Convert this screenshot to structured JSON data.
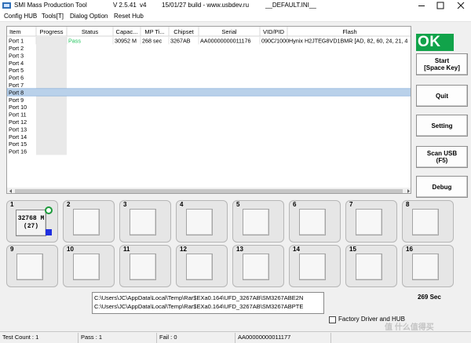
{
  "window": {
    "title": "SMI Mass Production Tool",
    "version": "V 2.5.41",
    "variant": "v4",
    "build": "15/01/27 build - www.usbdev.ru",
    "ini": "__DEFAULT.INI__"
  },
  "menu": [
    "Config HUB",
    "Tools[T]",
    "Dialog Option",
    "Reset Hub"
  ],
  "table": {
    "columns": [
      "Item",
      "Progress",
      "Status",
      "Capac...",
      "MP Ti...",
      "Chipset",
      "Serial",
      "VID/PID",
      "Flash"
    ],
    "rows": [
      {
        "item": "Port 1",
        "status": "Pass",
        "capacity": "30952 M",
        "mp_time": "268 sec",
        "chipset": "3267AB",
        "serial": "AA00000000011176",
        "vidpid": "090C/1000",
        "flash": "Hynix H2JTEG8VD1BMR [AD, 82, 60, 24, 21, 4"
      },
      {
        "item": "Port 2"
      },
      {
        "item": "Port 3"
      },
      {
        "item": "Port 4"
      },
      {
        "item": "Port 5"
      },
      {
        "item": "Port 6"
      },
      {
        "item": "Port 7"
      },
      {
        "item": "Port 8"
      },
      {
        "item": "Port 9"
      },
      {
        "item": "Port 10"
      },
      {
        "item": "Port 11"
      },
      {
        "item": "Port 12"
      },
      {
        "item": "Port 13"
      },
      {
        "item": "Port 14"
      },
      {
        "item": "Port 15"
      },
      {
        "item": "Port 16"
      }
    ],
    "selected_row": "Port 8"
  },
  "side_buttons": {
    "ok": "OK",
    "start_line1": "Start",
    "start_line2": "[Space Key]",
    "quit": "Quit",
    "setting": "Setting",
    "scan_line1": "Scan USB",
    "scan_line2": "(F5)",
    "debug": "Debug"
  },
  "slots": {
    "numbers": [
      "1",
      "2",
      "3",
      "4",
      "5",
      "6",
      "7",
      "8",
      "9",
      "10",
      "11",
      "12",
      "13",
      "14",
      "15",
      "16"
    ],
    "slot1_capacity": "32768 M",
    "slot1_count": "(27)"
  },
  "paths": [
    "C:\\Users\\JC\\AppData\\Local\\Temp\\Rar$EXa0.164\\UFD_3267AB\\SM3267ABE2N",
    "C:\\Users\\JC\\AppData\\Local\\Temp\\Rar$EXa0.164\\UFD_3267AB\\SM3267ABPTE"
  ],
  "elapsed": "269 Sec",
  "factory_option": "Factory Driver and HUB",
  "status_bar": {
    "test_count": "Test Count : 1",
    "pass": "Pass : 1",
    "fail": "Fail : 0",
    "serial": "AA00000000011177"
  },
  "watermark": "值 什么值得买",
  "colors": {
    "ok_green": "#11a34a",
    "pass_green": "#22c55e",
    "selection": "#b9d1ea",
    "slot_blue": "#1f2fe0"
  }
}
